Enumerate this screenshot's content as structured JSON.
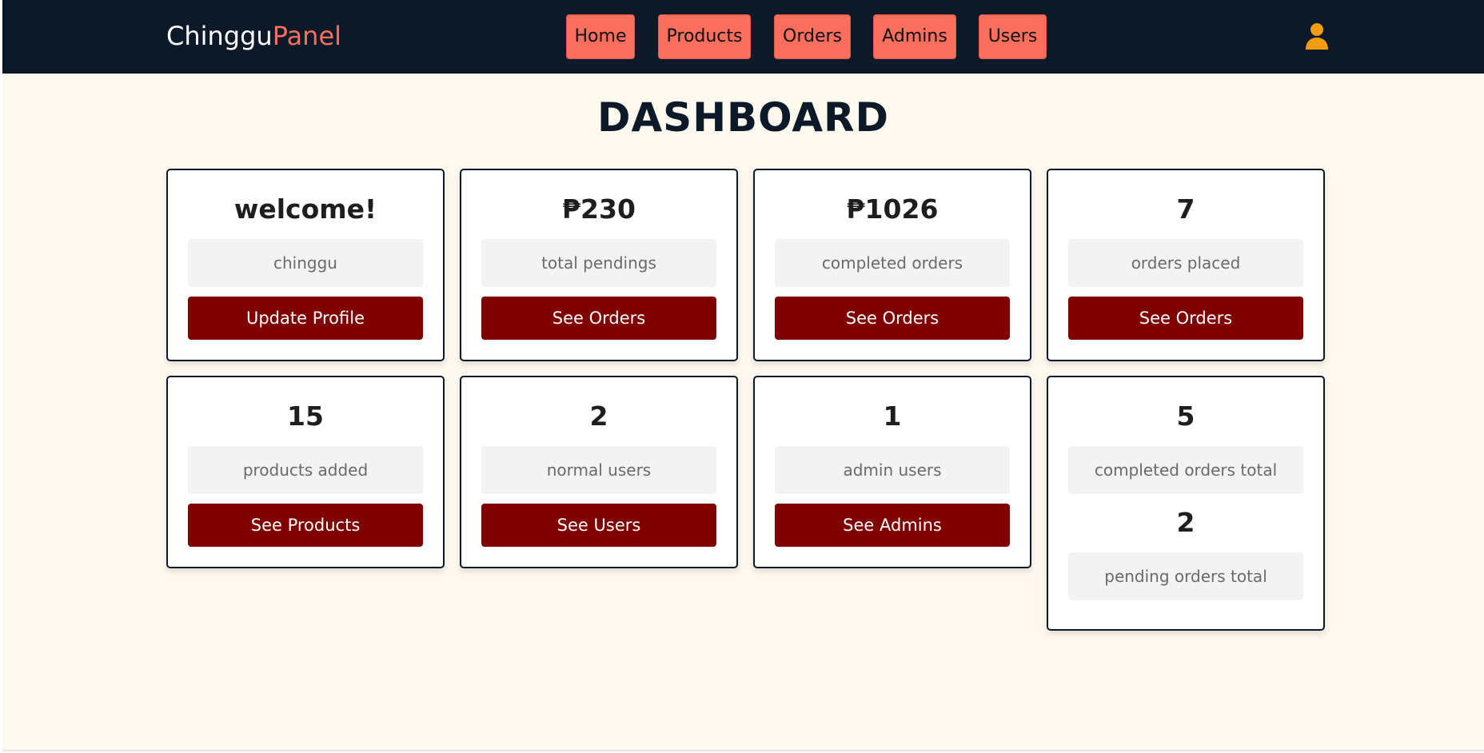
{
  "brand": {
    "name": "Chinggu",
    "accent": "Panel"
  },
  "nav": {
    "items": [
      "Home",
      "Products",
      "Orders",
      "Admins",
      "Users"
    ],
    "user_icon": "user-icon"
  },
  "page": {
    "title": "DASHBOARD"
  },
  "cards": [
    {
      "value": "welcome!",
      "info": "chinggu",
      "button": "Update Profile"
    },
    {
      "value": "₱230",
      "info": "total pendings",
      "button": "See Orders"
    },
    {
      "value": "₱1026",
      "info": "completed orders",
      "button": "See Orders"
    },
    {
      "value": "7",
      "info": "orders placed",
      "button": "See Orders"
    },
    {
      "value": "15",
      "info": "products added",
      "button": "See Products"
    },
    {
      "value": "2",
      "info": "normal users",
      "button": "See Users"
    },
    {
      "value": "1",
      "info": "admin users",
      "button": "See Admins"
    },
    {
      "value": "5",
      "info": "completed orders total",
      "value2": "2",
      "info2": "pending orders total"
    }
  ],
  "colors": {
    "header_bg": "#0b1929",
    "accent": "#fa6e5e",
    "button_bg": "#800000",
    "page_bg": "#fdf9ee",
    "user_icon": "#f39c12"
  }
}
